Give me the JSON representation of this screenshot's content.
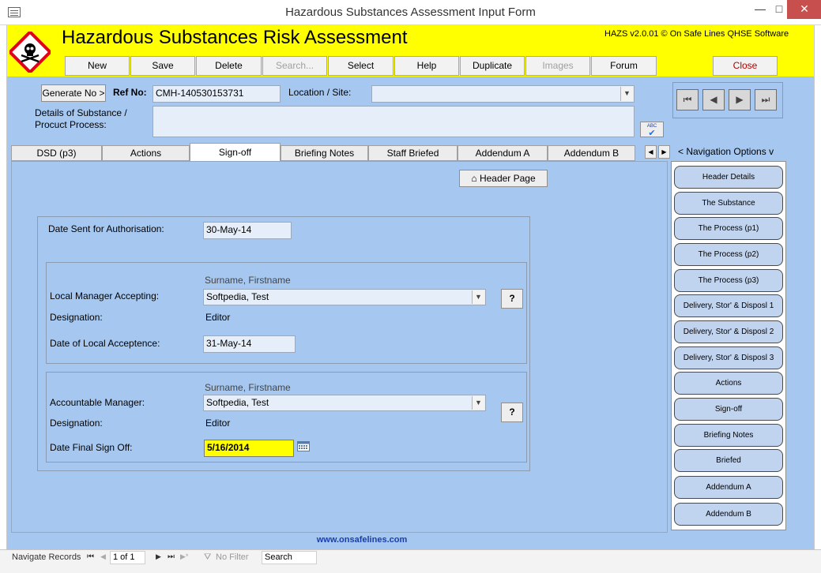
{
  "window": {
    "title": "Hazardous Substances Assessment Input Form",
    "minimize": "—",
    "maximize": "□",
    "close": "✕"
  },
  "header": {
    "title": "Hazardous Substances Risk Assessment",
    "version": "HAZS v2.0.01 © On Safe Lines QHSE Software",
    "toolbar": [
      {
        "label": "New",
        "enabled": true
      },
      {
        "label": "Save",
        "enabled": true
      },
      {
        "label": "Delete",
        "enabled": true
      },
      {
        "label": "Search...",
        "enabled": false
      },
      {
        "label": "Select",
        "enabled": true
      },
      {
        "label": "Help",
        "enabled": true
      },
      {
        "label": "Duplicate",
        "enabled": true
      },
      {
        "label": "Images",
        "enabled": false
      },
      {
        "label": "Forum",
        "enabled": true
      }
    ],
    "close_label": "Close"
  },
  "form": {
    "generate_label": "Generate No >",
    "ref_label": "Ref No:",
    "ref_value": "CMH-140530153731",
    "location_label": "Location / Site:",
    "location_value": "",
    "details_label_1": "Details of Substance /",
    "details_label_2": "Procuct Process:",
    "details_value": "",
    "spell_label": "ABC"
  },
  "record_nav": {
    "first": "⏮",
    "prev": "◀",
    "next": "▶",
    "last": "⏭"
  },
  "tabs": [
    {
      "label": "DSD (p3)"
    },
    {
      "label": "Actions"
    },
    {
      "label": "Sign-off",
      "active": true
    },
    {
      "label": "Briefing Notes"
    },
    {
      "label": "Staff Briefed"
    },
    {
      "label": "Addendum A"
    },
    {
      "label": "Addendum B"
    }
  ],
  "tab_scroll": {
    "left": "◀",
    "right": "▶"
  },
  "nav_options_label": "< Navigation Options v",
  "signoff": {
    "header_page_label": "Header Page",
    "date_sent_label": "Date Sent for Authorisation:",
    "date_sent_value": "30-May-14",
    "local": {
      "name_hint": "Surname, Firstname",
      "manager_label": "Local Manager Accepting:",
      "manager_value": "Softpedia, Test",
      "designation_label": "Designation:",
      "designation_value": "Editor",
      "date_label": "Date of Local Acceptence:",
      "date_value": "31-May-14",
      "help_label": "?"
    },
    "accountable": {
      "name_hint": "Surname, Firstname",
      "manager_label": "Accountable Manager:",
      "manager_value": "Softpedia, Test",
      "designation_label": "Designation:",
      "designation_value": "Editor",
      "date_label": "Date Final Sign Off:",
      "date_value": "5/16/2014",
      "help_label": "?"
    }
  },
  "side_nav": [
    "Header Details",
    "The Substance",
    "The Process (p1)",
    "The Process (p2)",
    "The Process (p3)",
    "Delivery, Stor' & Disposl 1",
    "Delivery, Stor' & Disposl 2",
    "Delivery, Stor' & Disposl 3",
    "Actions",
    "Sign-off",
    "Briefing Notes",
    "Briefed",
    "Addendum A",
    "Addendum B"
  ],
  "footer": {
    "link": "www.onsafelines.com"
  },
  "statusbar": {
    "navigate_label": "Navigate Records",
    "first": "⏮",
    "prev": "◀",
    "record_value": "1 of 1",
    "next": "▶",
    "last": "⏭",
    "new": "▶*",
    "filter_label": "No Filter",
    "search_label": "Search"
  },
  "colors": {
    "header_bg": "#ffff00",
    "form_bg": "#a6c8f0",
    "highlight_field": "#ffff00",
    "link": "#1a3ea8"
  }
}
